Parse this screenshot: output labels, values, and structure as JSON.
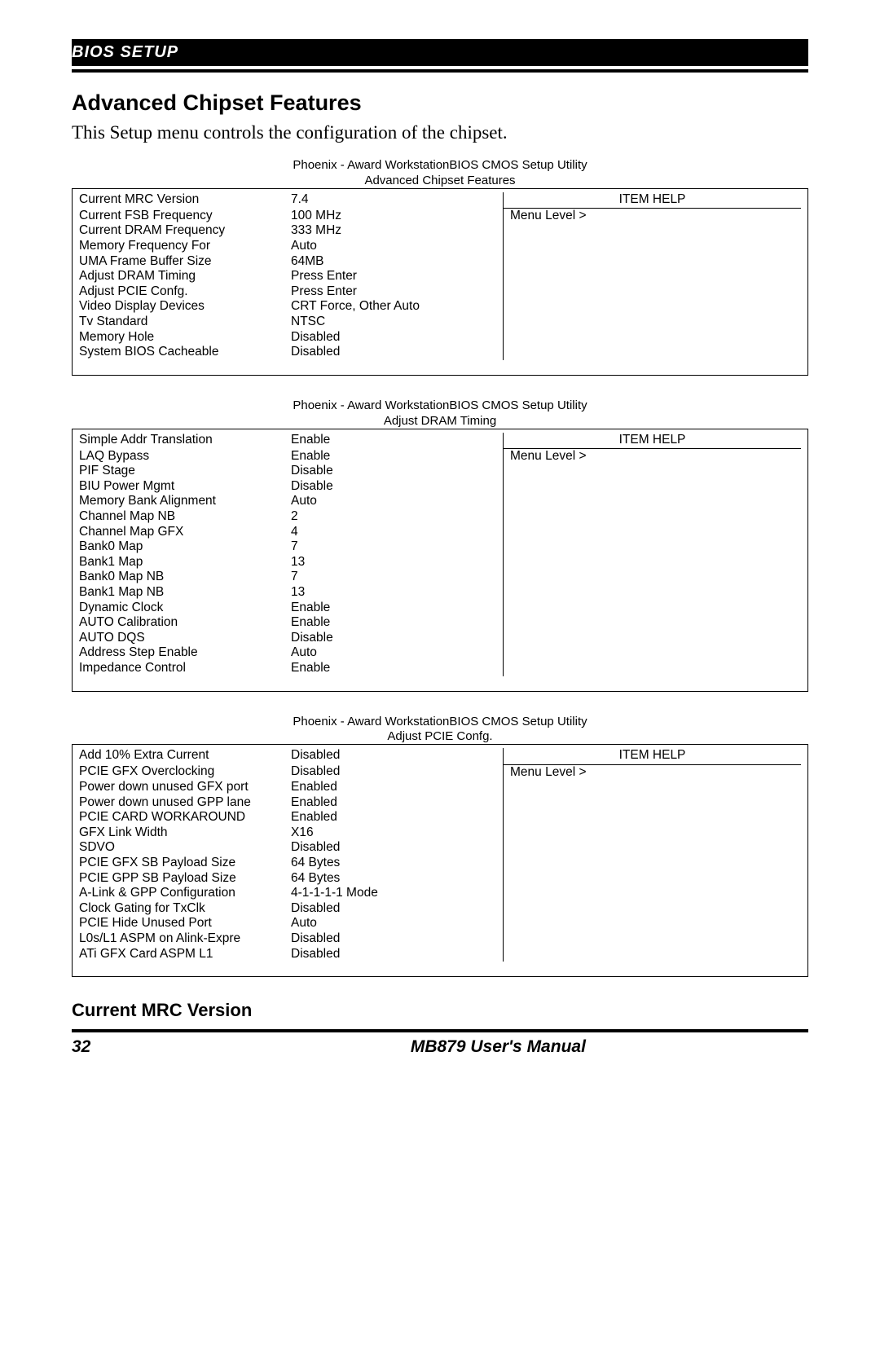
{
  "header": {
    "title": "BIOS SETUP"
  },
  "section": {
    "title": "Advanced Chipset Features",
    "desc": "This Setup menu controls the configuration of the chipset."
  },
  "blocks": [
    {
      "caption": "Phoenix - Award WorkstationBIOS CMOS Setup Utility",
      "subcaption": "Advanced Chipset Features",
      "help_title": "ITEM HELP",
      "help_menu": "Menu Level  >",
      "rows": [
        {
          "label": "Current MRC Version",
          "value": "7.4"
        },
        {
          "label": "Current FSB Frequency",
          "value": "100 MHz"
        },
        {
          "label": "Current DRAM Frequency",
          "value": "333 MHz"
        },
        {
          "label": "Memory Frequency For",
          "value": "Auto"
        },
        {
          "label": "UMA Frame Buffer Size",
          "value": "64MB"
        },
        {
          "label": "Adjust DRAM Timing",
          "value": "Press Enter"
        },
        {
          "label": "Adjust PCIE Confg.",
          "value": "Press Enter"
        },
        {
          "label": "Video Display Devices",
          "value": "CRT Force, Other Auto"
        },
        {
          "label": "Tv Standard",
          "value": "NTSC"
        },
        {
          "label": "Memory Hole",
          "value": "Disabled"
        },
        {
          "label": "System BIOS Cacheable",
          "value": "Disabled"
        }
      ]
    },
    {
      "caption": "Phoenix - Award WorkstationBIOS CMOS Setup Utility",
      "subcaption": "Adjust DRAM Timing",
      "help_title": "ITEM HELP",
      "help_menu": "Menu Level  >",
      "rows": [
        {
          "label": "Simple Addr Translation",
          "value": "Enable"
        },
        {
          "label": "LAQ Bypass",
          "value": "Enable"
        },
        {
          "label": "PIF Stage",
          "value": "Disable"
        },
        {
          "label": "BIU Power Mgmt",
          "value": "Disable"
        },
        {
          "label": "Memory Bank Alignment",
          "value": "Auto"
        },
        {
          "label": "Channel Map NB",
          "value": "2"
        },
        {
          "label": "Channel Map GFX",
          "value": "4"
        },
        {
          "label": "Bank0 Map",
          "value": "7"
        },
        {
          "label": "Bank1 Map",
          "value": "13"
        },
        {
          "label": "Bank0 Map NB",
          "value": "7"
        },
        {
          "label": "Bank1 Map NB",
          "value": "13"
        },
        {
          "label": "Dynamic Clock",
          "value": "Enable"
        },
        {
          "label": "AUTO Calibration",
          "value": "Enable"
        },
        {
          "label": "AUTO DQS",
          "value": "Disable"
        },
        {
          "label": "Address Step Enable",
          "value": "Auto"
        },
        {
          "label": "Impedance Control",
          "value": "Enable"
        }
      ]
    },
    {
      "caption": "Phoenix - Award WorkstationBIOS CMOS Setup Utility",
      "subcaption": "Adjust PCIE Confg.",
      "help_title": "ITEM HELP",
      "help_menu": "Menu Level  >",
      "rows": [
        {
          "label": "Add 10% Extra Current",
          "value": "Disabled"
        },
        {
          "label": "PCIE GFX Overclocking",
          "value": "Disabled"
        },
        {
          "label": "Power down unused GFX port",
          "value": "Enabled"
        },
        {
          "label": "Power down unused GPP lane",
          "value": "Enabled"
        },
        {
          "label": "PCIE CARD WORKAROUND",
          "value": "Enabled"
        },
        {
          "label": "GFX Link Width",
          "value": "X16"
        },
        {
          "label": "SDVO",
          "value": "Disabled"
        },
        {
          "label": "PCIE GFX SB Payload Size",
          "value": "64 Bytes"
        },
        {
          "label": "PCIE GPP SB Payload Size",
          "value": "64 Bytes"
        },
        {
          "label": "A-Link & GPP Configuration",
          "value": "4-1-1-1-1 Mode"
        },
        {
          "label": "Clock Gating for TxClk",
          "value": "Disabled"
        },
        {
          "label": "PCIE Hide Unused Port",
          "value": "Auto"
        },
        {
          "label": "L0s/L1 ASPM on Alink-Expre",
          "value": "Disabled"
        },
        {
          "label": "ATi GFX Card ASPM L1",
          "value": "Disabled"
        }
      ]
    }
  ],
  "footer": {
    "subtitle": "Current MRC Version",
    "page": "32",
    "manual": "MB879 User's Manual"
  }
}
